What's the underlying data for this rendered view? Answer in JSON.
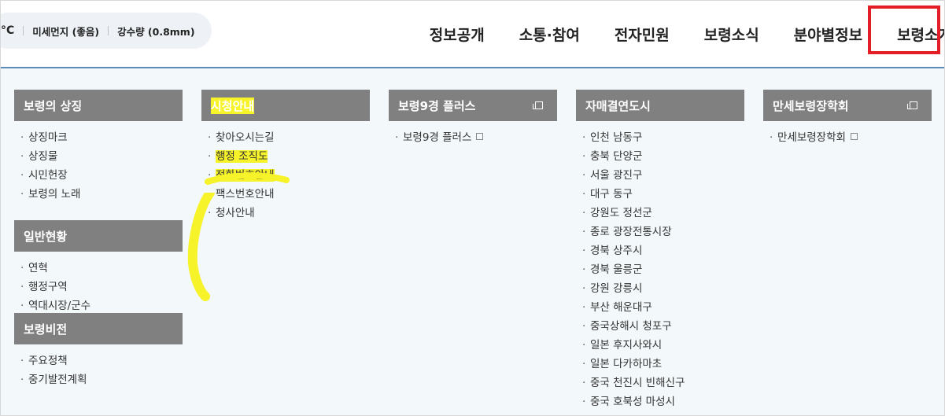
{
  "weather": {
    "temp_fragment": "°C",
    "dust": "미세먼지 (좋음)",
    "rain": "강수량 (0.8mm)"
  },
  "nav": {
    "items": [
      "정보공개",
      "소통·참여",
      "전자민원",
      "보령소식",
      "분야별정보",
      "보령소개"
    ]
  },
  "menu": {
    "col1": {
      "title": "보령의 상징",
      "items": [
        "상징마크",
        "상징물",
        "시민헌장",
        "보령의 노래"
      ]
    },
    "col1b": {
      "title": "일반현황",
      "items": [
        "연혁",
        "행정구역",
        "역대시장/군수"
      ]
    },
    "col1c": {
      "title": "보령비전",
      "items": [
        "주요정책",
        "중기발전계획"
      ]
    },
    "col2": {
      "title": "시청안내",
      "items": [
        "찾아오시는길",
        "행정 조직도",
        "전화번호안내",
        "팩스번호안내",
        "청사안내"
      ]
    },
    "col3": {
      "title": "보령9경 플러스",
      "items": [
        "보령9경 플러스"
      ]
    },
    "col4": {
      "title": "자매결연도시",
      "items": [
        "인천 남동구",
        "충북 단양군",
        "서울 광진구",
        "대구 동구",
        "강원도 정선군",
        "종로 광장전통시장",
        "경북 상주시",
        "경북 울릉군",
        "강원 강릉시",
        "부산 해운대구",
        "중국상해시 청포구",
        "일본 후지사와시",
        "일본 다카하마초",
        "중국 천진시 빈해신구",
        "중국 호북성 마성시"
      ]
    },
    "col5": {
      "title": "만세보령장학회",
      "items": [
        "만세보령장학회"
      ]
    }
  },
  "colors": {
    "header_bg": "#ffffff",
    "menu_bg": "#f3f8fb",
    "column_header_bg": "#808080",
    "highlight_box": "#e41e26",
    "marker_yellow": "#f7f32a",
    "divider": "#5a8ab8"
  }
}
